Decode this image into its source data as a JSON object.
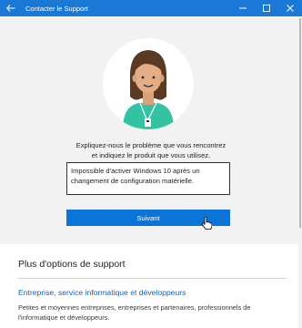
{
  "window": {
    "title": "Contacter le Support",
    "back_icon": "back-arrow-icon",
    "minimize_icon": "minimize-icon",
    "maximize_icon": "maximize-icon",
    "close_icon": "close-icon",
    "accent_color": "#1a78d6"
  },
  "main": {
    "avatar_icon": "support-agent-avatar",
    "prompt_line1": "Expliquez-nous le problème que vous rencontrez",
    "prompt_line2": "et indiquez le produit que vous utilisez.",
    "input_line1": "Impossible d'activer Windows 10 après un",
    "input_line2": "changement de configuration matérielle.",
    "submit_label": "Suivant",
    "button_color": "#0a74d8"
  },
  "more_options": {
    "title": "Plus d'options de support",
    "link_label": "Entreprise, service informatique et développeurs",
    "desc_line1": "Petites et moyennes entreprises, entreprises et partenaires, professionnels de",
    "desc_line2": "l'informatique et développeurs.",
    "link_color": "#0a64c2"
  }
}
